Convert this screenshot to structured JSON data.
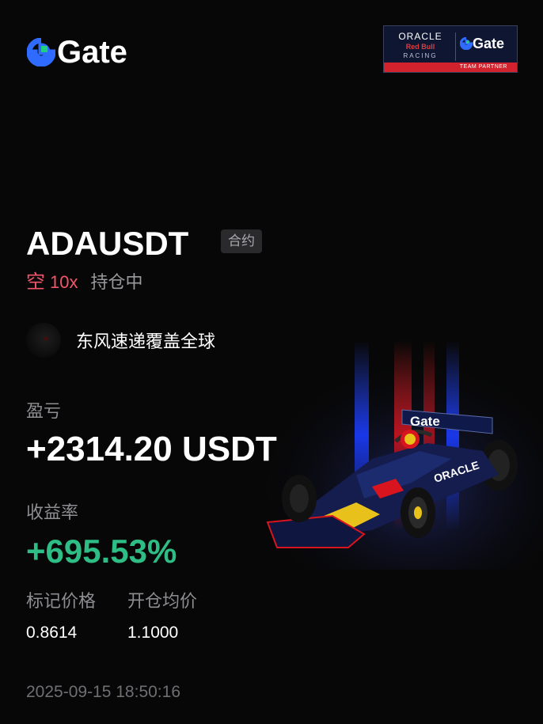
{
  "brand": {
    "name": "Gate",
    "color": "#2f6bff",
    "accent": "#1fd07f"
  },
  "partner": {
    "oracle": "ORACLE",
    "redbull": "Red Bull",
    "racing": "RACING",
    "gate": "Gate",
    "strip": "TEAM PARTNER"
  },
  "position": {
    "pair": "ADAUSDT",
    "tag": "合约",
    "side": "空",
    "leverage": "10x",
    "status": "持仓中"
  },
  "user": {
    "name": "东风速递覆盖全球"
  },
  "pnl": {
    "label": "盈亏",
    "value": "+2314.20 USDT"
  },
  "roi": {
    "label": "收益率",
    "value": "+695.53%"
  },
  "prices": {
    "mark_label": "标记价格",
    "mark_value": "0.8614",
    "entry_label": "开仓均价",
    "entry_value": "1.1000"
  },
  "timestamp": "2025-09-15 18:50:16",
  "colors": {
    "short": "#f0566a",
    "profit": "#2ebd85",
    "muted": "#8d8d92",
    "background": "#070707"
  },
  "car_livery": "Gate"
}
